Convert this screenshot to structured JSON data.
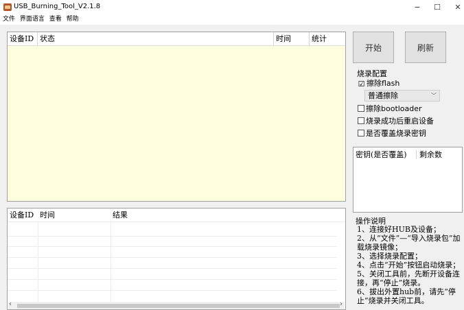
{
  "window": {
    "title": "USB_Burning_Tool_V2.1.8",
    "minimize": "−",
    "maximize": "☐",
    "close": "✕"
  },
  "menu": [
    "文件",
    "界面语言",
    "查看",
    "帮助"
  ],
  "top_table": {
    "columns": [
      "设备ID",
      "状态",
      "时间",
      "统计"
    ]
  },
  "bottom_table": {
    "columns": [
      "设备ID",
      "时间",
      "结果"
    ],
    "scroll_left": "‹",
    "scroll_right": "›"
  },
  "buttons": {
    "start": "开始",
    "refresh": "刷新"
  },
  "burn_config": {
    "title": "烧录配置",
    "erase_flash": {
      "label_cn": "擦除",
      "label_en": "flash",
      "checked": true
    },
    "erase_mode": "普通擦除",
    "erase_bootloader": {
      "label_cn": "擦除",
      "label_en": "bootloader",
      "checked": false
    },
    "reboot_after": {
      "label": "烧录成功后重启设备",
      "checked": false
    },
    "overwrite_key": {
      "label": "是否覆盖烧录密钥",
      "checked": false
    },
    "check_mark": "☑"
  },
  "key_list": {
    "col1": "密钥(是否覆盖)",
    "col2": "剩余数"
  },
  "instructions": {
    "title": "操作说明",
    "lines": [
      "1、连接好HUB及设备；",
      "2、从“文件”—“导入烧录包”加载烧录镜像；",
      "3、选择烧录配置；",
      "4、点击“开始”按钮启动烧录；",
      "5、关闭工具前，先断开设备连接，再“停止”烧录。",
      "6、拔出外置hub前，请先“停止”烧录并关闭工具。"
    ]
  }
}
